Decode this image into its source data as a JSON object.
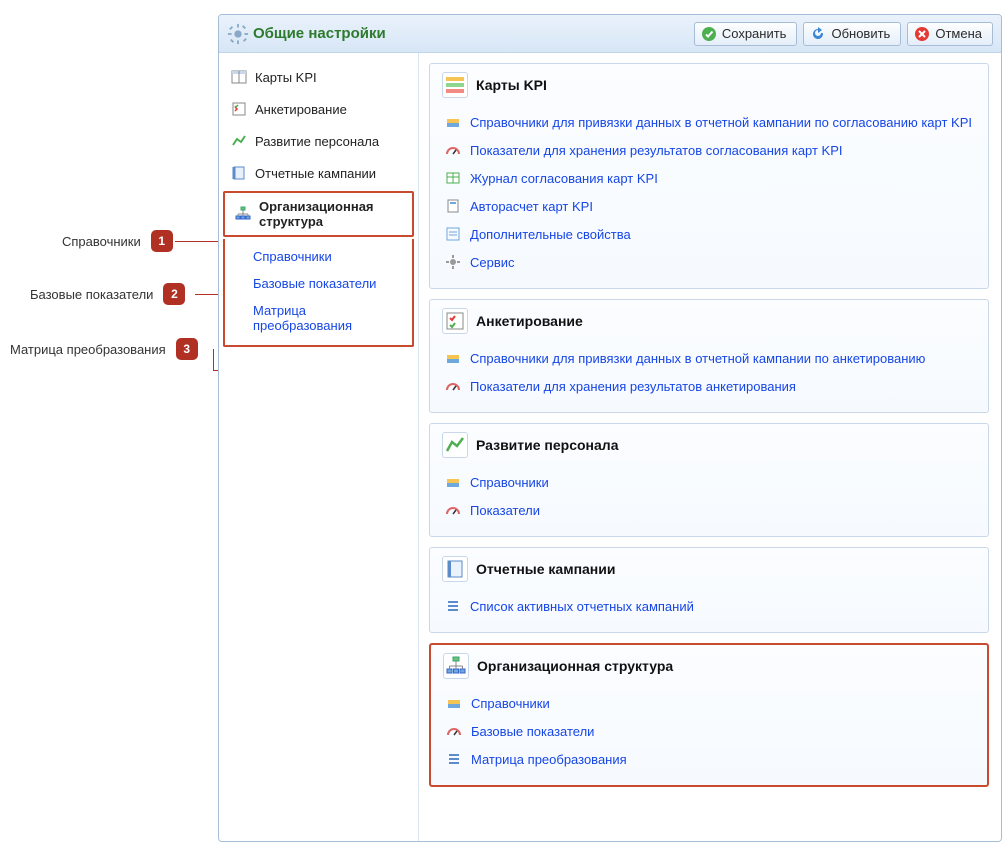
{
  "window": {
    "title": "Общие настройки"
  },
  "toolbar": {
    "save": "Сохранить",
    "refresh": "Обновить",
    "cancel": "Отмена"
  },
  "nav": {
    "items": [
      {
        "label": "Карты KPI"
      },
      {
        "label": "Анкетирование"
      },
      {
        "label": "Развитие персонала"
      },
      {
        "label": "Отчетные кампании"
      },
      {
        "label": "Организационная структура"
      }
    ],
    "expanded": {
      "sub": [
        "Справочники",
        "Базовые показатели",
        "Матрица преобразования"
      ]
    }
  },
  "sections": {
    "kpi": {
      "title": "Карты KPI",
      "items": [
        "Справочники для привязки данных в отчетной кампании по согласованию карт KPI",
        "Показатели для хранения результатов согласования карт KPI",
        "Журнал согласования карт KPI",
        "Авторасчет карт KPI",
        "Дополнительные свойства",
        "Сервис"
      ]
    },
    "survey": {
      "title": "Анкетирование",
      "items": [
        "Справочники для привязки данных в отчетной кампании по анкетированию",
        "Показатели для хранения результатов анкетирования"
      ]
    },
    "dev": {
      "title": "Развитие персонала",
      "items": [
        "Справочники",
        "Показатели"
      ]
    },
    "reports": {
      "title": "Отчетные кампании",
      "items": [
        "Список активных отчетных кампаний"
      ]
    },
    "org": {
      "title": "Организационная структура",
      "items": [
        "Справочники",
        "Базовые показатели",
        "Матрица преобразования"
      ]
    }
  },
  "callouts": {
    "c1": {
      "num": "1",
      "label": "Справочники"
    },
    "c2": {
      "num": "2",
      "label": "Базовые показатели"
    },
    "c3": {
      "num": "3",
      "label": "Матрица преобразования"
    }
  }
}
